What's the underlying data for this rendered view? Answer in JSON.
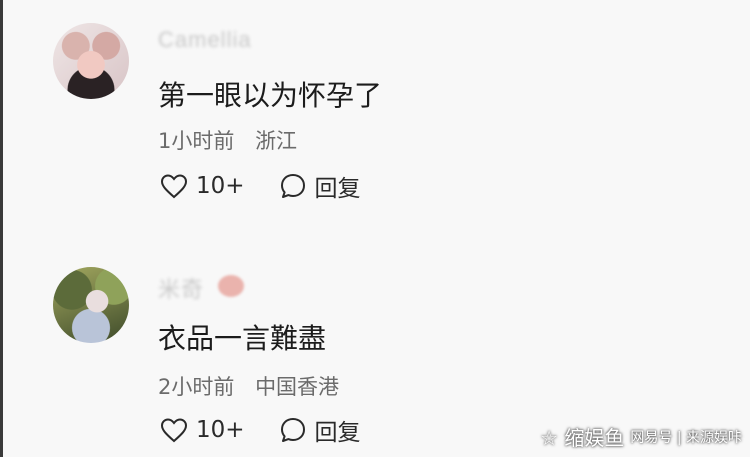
{
  "comments": [
    {
      "username": "Camellia",
      "text": "第一眼以为怀孕了",
      "time": "1小时前",
      "location": "浙江",
      "like_count": "10+",
      "reply_label": "回复"
    },
    {
      "username": "米奇",
      "text": "衣品一言難盡",
      "time": "2小时前",
      "location": "中国香港",
      "like_count": "10+",
      "reply_label": "回复"
    }
  ],
  "watermark": {
    "main": "☆ 缩娱鱼",
    "sub": "网易号 | 来源娱咔"
  }
}
